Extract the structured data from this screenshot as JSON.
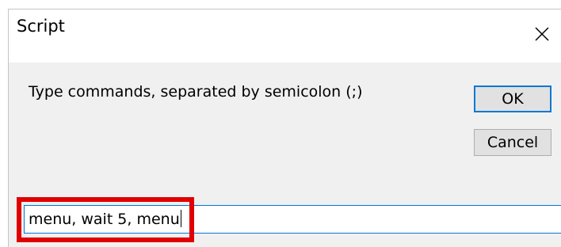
{
  "dialog": {
    "title": "Script",
    "close_icon": "close-icon",
    "prompt": "Type commands, separated by semicolon (;)",
    "ok_label": "OK",
    "cancel_label": "Cancel",
    "input_value": "menu, wait 5, menu"
  },
  "colors": {
    "focus_border": "#0078d7",
    "highlight": "#e00000",
    "dialog_bg": "#f0f0f0",
    "button_bg": "#e1e1e1"
  }
}
